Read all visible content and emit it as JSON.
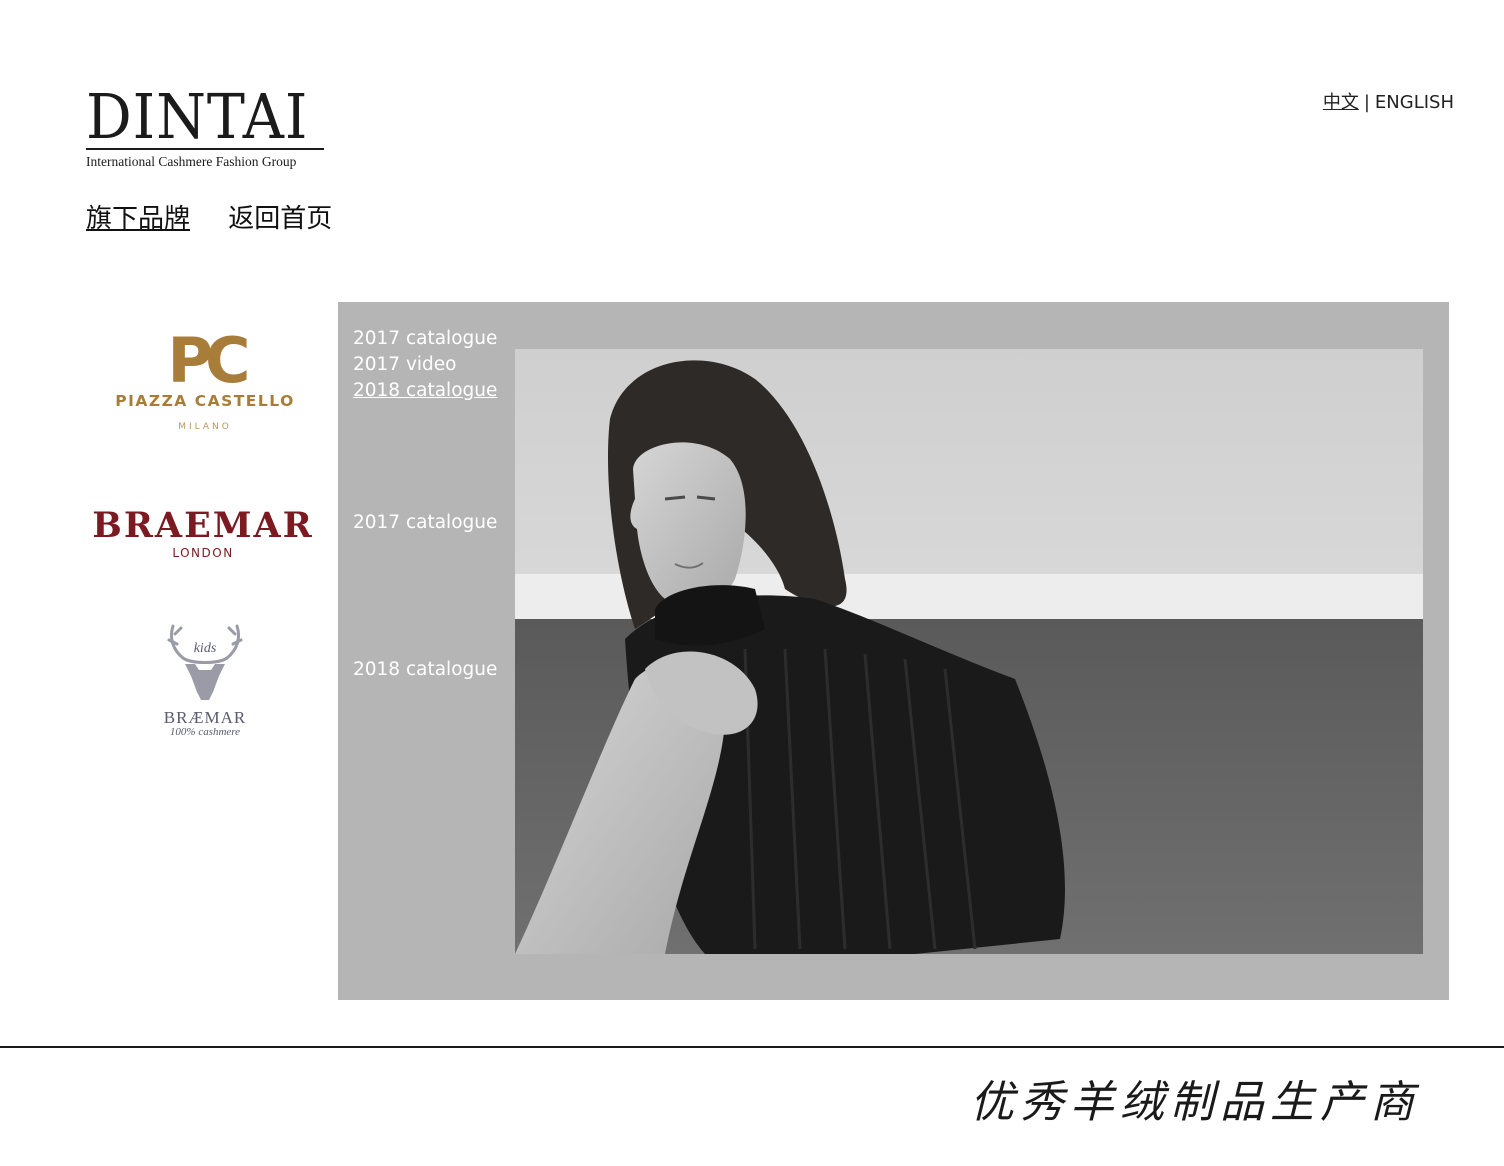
{
  "header": {
    "logo_word": "DINTAI",
    "logo_tagline": "International Cashmere Fashion Group"
  },
  "lang": {
    "chinese": "中文",
    "separator": "|",
    "english": "ENGLISH"
  },
  "nav": {
    "brands": "旗下品牌",
    "home": "返回首页"
  },
  "brands": {
    "piazza": {
      "mark": "PC",
      "name": "PIAZZA CASTELLO",
      "city": "MILANO"
    },
    "braemar": {
      "name": "BRAEMAR",
      "city": "LONDON"
    },
    "kids": {
      "badge": "kids",
      "name": "BRÆMAR",
      "sub": "100% cashmere"
    }
  },
  "panel": {
    "piazza_links": [
      "2017 catalogue",
      "2017 video",
      "2018 catalogue"
    ],
    "braemar_links": [
      "2017 catalogue"
    ],
    "kids_links": [
      "2018 catalogue"
    ]
  },
  "footer": {
    "slogan": "优秀羊绒制品生产商"
  },
  "colors": {
    "panel": "#b5b5b5",
    "piazza_gold": "#a87d3a",
    "braemar_red": "#7c1a21",
    "kids_grey": "#9b9ba8"
  }
}
